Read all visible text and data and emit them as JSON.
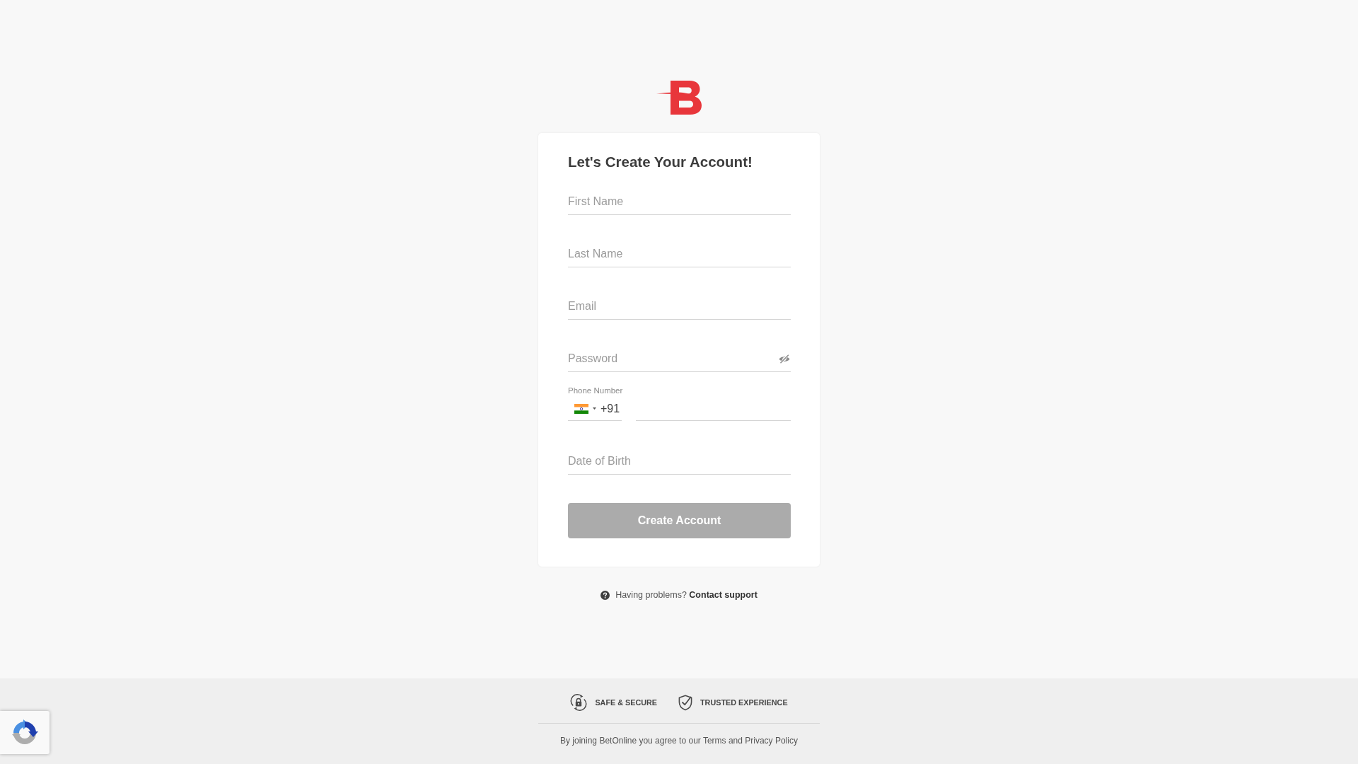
{
  "form": {
    "title": "Let's Create Your Account!",
    "fields": [
      {
        "kind": "text",
        "placeholder": "First Name"
      },
      {
        "kind": "text",
        "placeholder": "Last Name"
      },
      {
        "kind": "text",
        "placeholder": "Email"
      },
      {
        "kind": "password",
        "placeholder": "Password",
        "revealed": false
      },
      {
        "kind": "phone",
        "label": "Phone Number",
        "country_code": "+91"
      },
      {
        "kind": "text",
        "placeholder": "Date of Birth"
      }
    ],
    "submit": {
      "label": "Create Account",
      "disabled": true
    }
  },
  "help": {
    "text": "Having problems?",
    "link": "Contact support"
  },
  "footer": {
    "badges": [
      {
        "kind": "secure",
        "label": "SAFE & SECURE"
      },
      {
        "kind": "trusted",
        "label": "TRUSTED EXPERIENCE"
      }
    ],
    "legal": "By joining BetOnline you agree to our Terms and Privacy Policy"
  }
}
